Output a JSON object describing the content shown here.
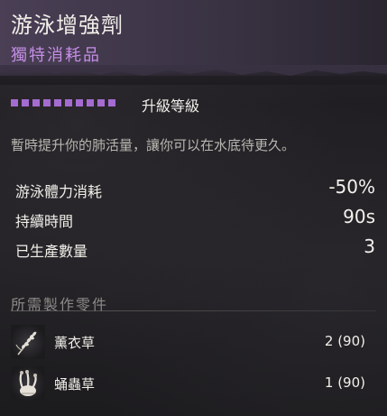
{
  "item": {
    "name": "游泳增強劑",
    "category": "獨特消耗品"
  },
  "level": {
    "pip_count": 10,
    "label": "升級等級",
    "pip_color": "#a46cd1"
  },
  "description": "暫時提升你的肺活量，讓你可以在水底待更久。",
  "stats": [
    {
      "label": "游泳體力消耗",
      "value": "-50%"
    },
    {
      "label": "持續時間",
      "value": "90s"
    },
    {
      "label": "已生產數量",
      "value": "3"
    }
  ],
  "materials_section": {
    "title": "所需製作零件",
    "items": [
      {
        "name": "薰衣草",
        "count": "2 (90)",
        "icon": "lavender-icon"
      },
      {
        "name": "蛹蟲草",
        "count": "1 (90)",
        "icon": "cordyceps-icon"
      }
    ]
  },
  "colors": {
    "header": "#4a3f55",
    "category_text": "#c58ee6",
    "text": "#f1efe9"
  }
}
